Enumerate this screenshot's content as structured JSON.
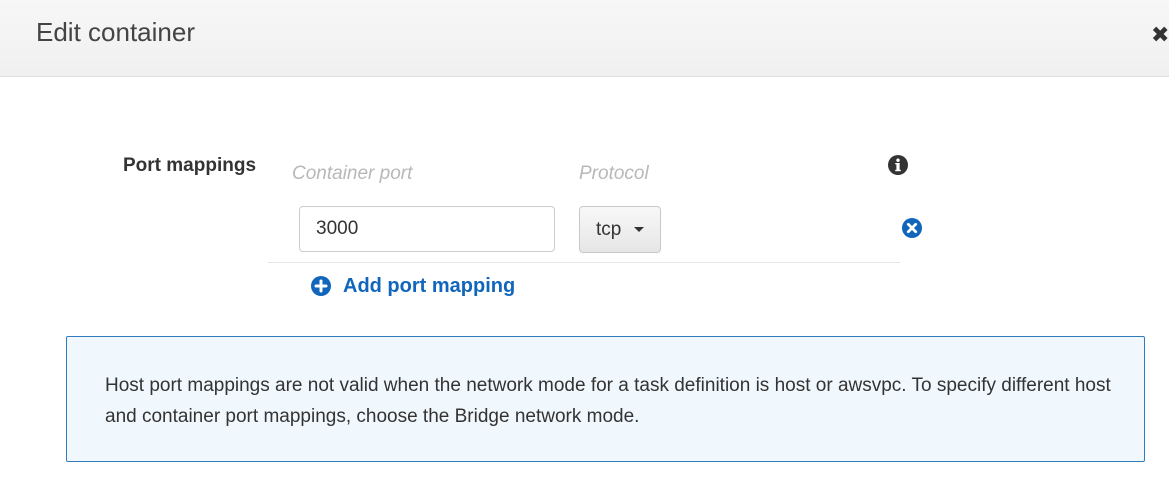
{
  "modal": {
    "title": "Edit container",
    "close_symbol": "✖"
  },
  "port_mappings": {
    "section_label": "Port mappings",
    "columns": {
      "container_port": "Container port",
      "protocol": "Protocol"
    },
    "rows": [
      {
        "container_port": "3000",
        "protocol": "tcp"
      }
    ],
    "add_label": "Add port mapping"
  },
  "notice": {
    "text": "Host port mappings are not valid when the network mode for a task definition is host or awsvpc. To specify different host and container port mappings, choose the Bridge network mode."
  },
  "icons": {
    "info": "info-circle-icon",
    "remove": "remove-circle-icon",
    "add": "plus-circle-icon",
    "close": "close-icon",
    "dropdown": "caret-down-icon"
  },
  "colors": {
    "link_blue": "#1166bb",
    "notice_border": "#2f7bbd",
    "notice_background": "#f1f8fd",
    "placeholder_gray": "#b8b8b8"
  }
}
